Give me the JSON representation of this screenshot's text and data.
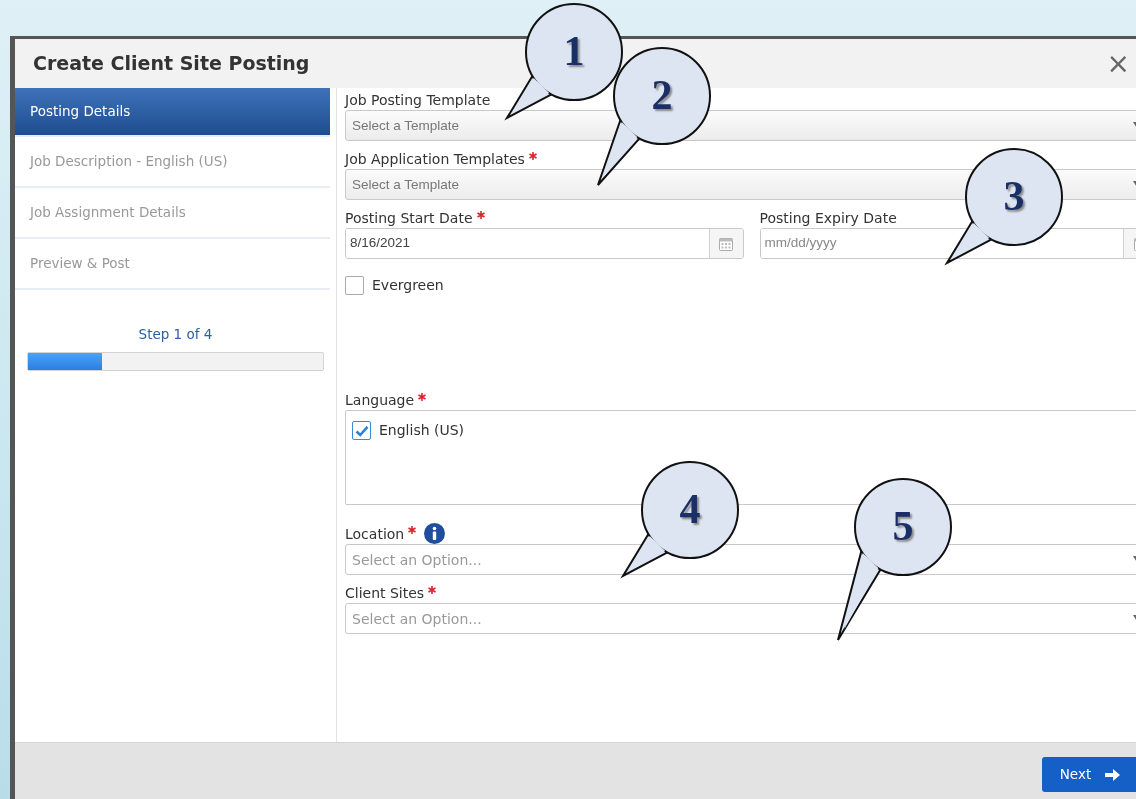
{
  "window": {
    "title": "Create Client Site Posting",
    "close": "×"
  },
  "steps": [
    {
      "label": "Posting Details",
      "selected": true,
      "disabled": false
    },
    {
      "label": "Job Description - English (US)",
      "selected": false,
      "disabled": true
    },
    {
      "label": "Job Assignment Details",
      "selected": false,
      "disabled": true
    },
    {
      "label": "Preview & Post",
      "selected": false,
      "disabled": true
    }
  ],
  "progress": {
    "text": "Step 1 of 4",
    "level": 0.25
  },
  "fields": [
    {
      "kind": "select",
      "label": "Job Posting Template",
      "required": false,
      "placeholder": "Select a Template"
    },
    {
      "kind": "select",
      "label": "Job Application Templates",
      "required": true,
      "placeholder": "Select a Template"
    },
    {
      "kind": "dates",
      "items": [
        {
          "label": "Posting Start Date",
          "required": true,
          "value": "8/16/2021"
        },
        {
          "label": "Posting Expiry Date",
          "required": false,
          "placeholder": "mm/dd/yyyy"
        }
      ]
    },
    {
      "kind": "checkbox",
      "label": "Evergreen",
      "checked": false
    },
    {
      "kind": "checklist",
      "label": "Language",
      "required": true,
      "options": [
        {
          "label": "English (US)",
          "checked": true
        }
      ]
    },
    {
      "kind": "combo",
      "label": "Location",
      "required": true,
      "info": true,
      "placeholder": "Select an Option..."
    },
    {
      "kind": "combo",
      "label": "Client Sites",
      "required": true,
      "info": false,
      "placeholder": "Select an Option..."
    }
  ],
  "footer": {
    "next_button": "Next"
  },
  "callouts": [
    {
      "number": "1"
    },
    {
      "number": "2"
    },
    {
      "number": "3"
    },
    {
      "number": "4"
    },
    {
      "number": "5"
    }
  ]
}
